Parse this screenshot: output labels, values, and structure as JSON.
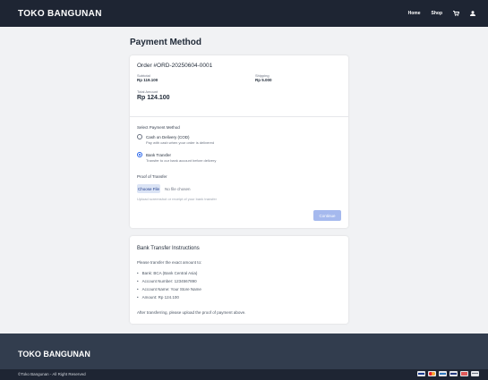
{
  "header": {
    "brand": "TOKO BANGUNAN",
    "nav": {
      "home": "Home",
      "shop": "Shop"
    }
  },
  "page": {
    "title": "Payment Method"
  },
  "order": {
    "number": "Order #ORD-20250604-0001",
    "subtotal_label": "Subtotal",
    "subtotal_value": "Rp 119.100",
    "shipping_label": "Shipping",
    "shipping_value": "Rp 5.000",
    "total_label": "Total Amount",
    "total_value": "Rp 124.100"
  },
  "payment": {
    "select_label": "Select Payment Method",
    "options": [
      {
        "title": "Cash on Delivery (COD)",
        "desc": "Pay with cash when your order is delivered",
        "checked": false
      },
      {
        "title": "Bank Transfer",
        "desc": "Transfer to our bank account before delivery",
        "checked": true
      }
    ],
    "proof_label": "Proof of Transfer",
    "choose_file": "Choose File",
    "file_status": "No file chosen",
    "hint": "Upload screenshot or receipt of your bank transfer",
    "continue": "Continue"
  },
  "instructions": {
    "title": "Bank Transfer Instructions",
    "intro": "Please transfer the exact amount to:",
    "items": [
      "Bank: BCA (Bank Central Asia)",
      "Account Number: 1234567890",
      "Account Name: Your Store Name",
      "Amount: Rp 124.100"
    ],
    "after": "After transferring, please upload the proof of payment above."
  },
  "footer": {
    "brand": "TOKO BANGUNAN",
    "copyright": "©Toko Bangunan - All Right Reserved"
  },
  "icons": {
    "cart": "cart-icon",
    "user": "user-icon",
    "payments": [
      "visa-icon",
      "mastercard-icon",
      "amex-icon",
      "paypal-icon",
      "discover-icon",
      "card-icon"
    ]
  },
  "colors": {
    "navbar": "#1e2533",
    "footer": "#323d4e",
    "accent": "#2563eb",
    "continue_disabled": "#a5b9ee"
  }
}
